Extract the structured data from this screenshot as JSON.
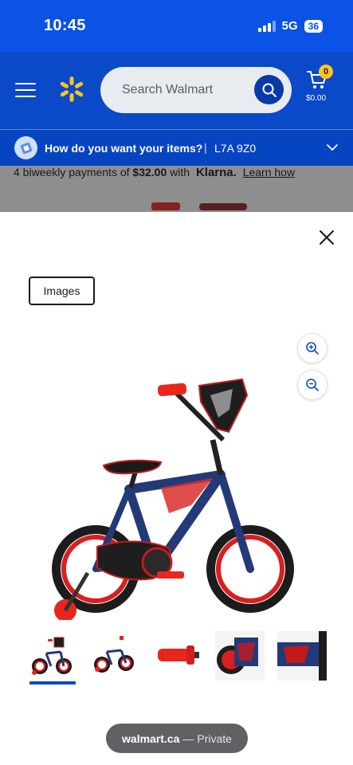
{
  "status_bar": {
    "time": "10:45",
    "network": "5G",
    "battery": "36"
  },
  "header": {
    "search_placeholder": "Search Walmart",
    "cart_count": "0",
    "cart_total": "$0.00",
    "brand_color": "#0a49c8",
    "spark_color": "#ffc220"
  },
  "delivery": {
    "question": "How do you want your items?",
    "separator": "|",
    "postal_code": "L7A 9Z0"
  },
  "background_page": {
    "klarna_prefix": "4 biweekly payments of",
    "klarna_amount": "$32.00",
    "klarna_with": "with",
    "klarna_logo": "Klarna.",
    "klarna_learn": "Learn how"
  },
  "modal": {
    "tab_label": "Images",
    "icons": {
      "close": "close-icon",
      "zoom_in": "zoom-in-icon",
      "zoom_out": "zoom-out-icon"
    },
    "selected_thumbnail": 1,
    "thumbnails": [
      "bike-side-view",
      "bike-angle-view",
      "handlebar-grip",
      "front-detail",
      "frame-detail"
    ]
  },
  "browser": {
    "domain": "walmart.ca",
    "separator": "—",
    "mode": "Private"
  }
}
